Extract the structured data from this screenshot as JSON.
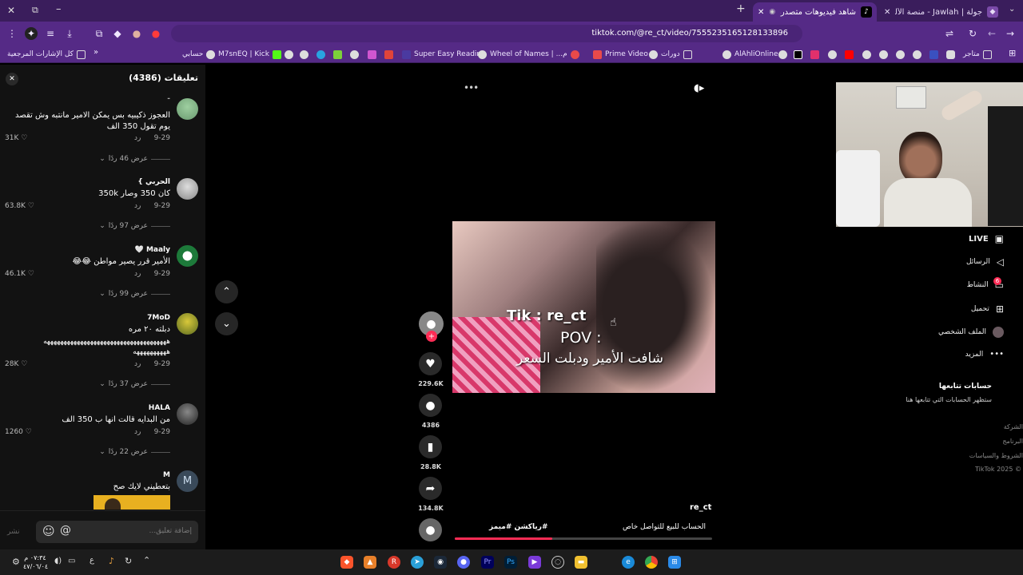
{
  "browser": {
    "tabs": [
      {
        "title": "جولة | Jawlah - منصة الألعاب الأ",
        "active": false
      },
      {
        "title": "شاهد فيديوهات متصدرة | Tik",
        "active": true
      }
    ],
    "new_tab": "+",
    "url": "tiktok.com/@re_ct/video/7555235165128133896",
    "bookmarks": [
      "كل الإشارات المرجعية",
      "حسابي",
      "M7snEQ | Kick",
      "Super Easy Reading",
      "Wheel of Names | ...م",
      "Prime Video",
      "دورات",
      "AlAhliOnline",
      "متاجر"
    ]
  },
  "comments": {
    "title": "تعليقات (4386)",
    "close": "✕",
    "items": [
      {
        "user": "-",
        "text": "العجوز ذكيبيه بس يمكن الامير مانتبه وش تقصد يوم تقول 350 الف",
        "date": "9-29",
        "reply": "رد",
        "likes": "31K",
        "replies": "عرض 46 ردًا"
      },
      {
        "user": "الحربي }",
        "text": "كان 350 وصار 350k",
        "date": "9-29",
        "reply": "رد",
        "likes": "63.8K",
        "replies": "عرض 97 ردًا"
      },
      {
        "user": "Maaly 🤍",
        "text": "الأمير قرر يصير مواطن 😂😂",
        "date": "9-29",
        "reply": "رد",
        "likes": "46.1K",
        "replies": "عرض 99 ردًا"
      },
      {
        "user": "7MoD",
        "text": "دبلته ٢٠ مره",
        "text2": "هههههههههههههههههههههههههههههههههههههه",
        "text3": "ههههههههههه",
        "date": "9-29",
        "reply": "رد",
        "likes": "28K",
        "replies": "عرض 37 ردًا"
      },
      {
        "user": "HALA",
        "text": "من البدايه قالت انها ب 350 الف",
        "date": "9-29",
        "reply": "رد",
        "likes": "1260",
        "replies": "عرض 22 ردًا"
      },
      {
        "user": "M",
        "text": "بتعطيني لايك صح"
      }
    ],
    "input_placeholder": "إضافة تعليق...",
    "post": "نشر"
  },
  "video": {
    "more": "•••",
    "caption_brand": "Tik : re_ct",
    "caption_pov": "POV :",
    "caption_text": "شافت الأمير ودبلت السعر",
    "author": "re_ct",
    "description": "الحساب للبيع للتواصل خاص",
    "hashtags": "#رياكشن #ميمز",
    "likes": "229.6K",
    "comments": "4386",
    "saves": "28.8K",
    "shares": "134.8K",
    "progress": 0.38
  },
  "sidebar": {
    "live": "LIVE",
    "items": [
      "الرسائل",
      "النشاط",
      "تحميل",
      "الملف الشخصي",
      "المزيد"
    ],
    "activity_badge": "6",
    "following_title": "حسابات تتابعها",
    "following_sub": "ستظهر الحسابات التي تتابعها هنا",
    "footer": [
      "الشركة",
      "البرنامج",
      "الشروط والسياسات",
      "TikTok 2025 ©"
    ]
  },
  "taskbar": {
    "time": "٠٧:٣٤ م",
    "date": "٤٧/٠٦/٠٤",
    "lang": "ع"
  },
  "colors": {
    "browser_purple": "#552a86",
    "tiktok_pink": "#fe2c55"
  }
}
